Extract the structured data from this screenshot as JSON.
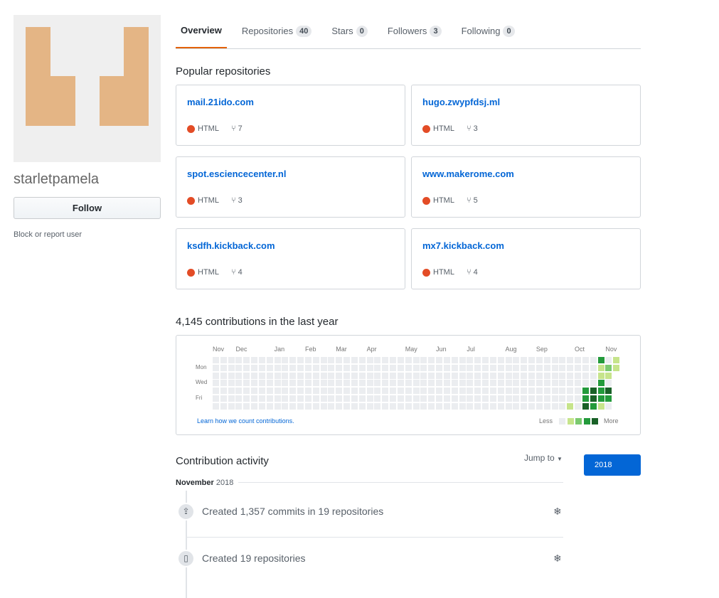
{
  "profile": {
    "username": "starletpamela",
    "follow_label": "Follow",
    "block_label": "Block or report user"
  },
  "tabs": [
    {
      "label": "Overview",
      "count": null
    },
    {
      "label": "Repositories",
      "count": "40"
    },
    {
      "label": "Stars",
      "count": "0"
    },
    {
      "label": "Followers",
      "count": "3"
    },
    {
      "label": "Following",
      "count": "0"
    }
  ],
  "popular": {
    "title": "Popular repositories",
    "repos": [
      {
        "name": "mail.21ido.com",
        "language": "HTML",
        "forks": "7"
      },
      {
        "name": "hugo.zwypfdsj.ml",
        "language": "HTML",
        "forks": "3"
      },
      {
        "name": "spot.esciencecenter.nl",
        "language": "HTML",
        "forks": "3"
      },
      {
        "name": "www.makerome.com",
        "language": "HTML",
        "forks": "5"
      },
      {
        "name": "ksdfh.kickback.com",
        "language": "HTML",
        "forks": "4"
      },
      {
        "name": "mx7.kickback.com",
        "language": "HTML",
        "forks": "4"
      }
    ],
    "language_color": "#e34c26"
  },
  "contributions": {
    "title": "4,145 contributions in the last year",
    "months": [
      "Nov",
      "Dec",
      "Jan",
      "Feb",
      "Mar",
      "Apr",
      "May",
      "Jun",
      "Jul",
      "Aug",
      "Sep",
      "Oct",
      "Nov"
    ],
    "days": [
      "Mon",
      "Wed",
      "Fri"
    ],
    "learn_link": "Learn how we count contributions.",
    "less": "Less",
    "more": "More",
    "colors": [
      "#ebedf0",
      "#c6e48b",
      "#7bc96f",
      "#239a3b",
      "#196127"
    ],
    "weeks": 53,
    "last_weeks_levels": [
      [
        0,
        0,
        0,
        0,
        0,
        0,
        1
      ],
      [
        0,
        0,
        0,
        0,
        0,
        0,
        0
      ],
      [
        0,
        0,
        0,
        0,
        3,
        3,
        4
      ],
      [
        0,
        0,
        0,
        0,
        4,
        4,
        3
      ],
      [
        3,
        1,
        1,
        3,
        3,
        3,
        1
      ],
      [
        0,
        2,
        1,
        0,
        4,
        3,
        0
      ],
      [
        1,
        1
      ]
    ]
  },
  "activity": {
    "title": "Contribution activity",
    "jump_label": "Jump to",
    "year": "2018",
    "month": "November",
    "month_year": "2018",
    "items": [
      {
        "text": "Created 1,357 commits in 19 repositories",
        "icon": "repo-push-icon"
      },
      {
        "text": "Created 19 repositories",
        "icon": "repo-icon"
      }
    ]
  }
}
